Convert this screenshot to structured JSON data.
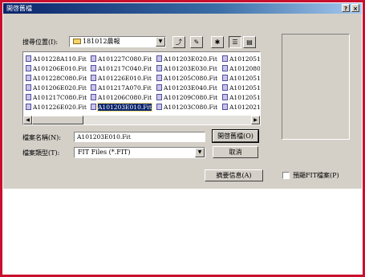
{
  "window": {
    "title": "開啓舊檔"
  },
  "titlebar_buttons": {
    "help": "?",
    "close": "×"
  },
  "look_in": {
    "label": "搜尋位置(I):",
    "value": "181012晨報",
    "tools": [
      "folder-up-icon",
      "refresh-icon",
      "new-folder-icon",
      "list-view-icon",
      "details-view-icon"
    ]
  },
  "files": {
    "columns": [
      [
        "A101228A110.Fit",
        "A101206E010.Fit",
        "A101228C080.Fit",
        "A101206E020.Fit",
        "A101217C080.Fit",
        "A101226E020.Fit"
      ],
      [
        "A101227C080.Fit",
        "A101217C040.Fit",
        "A101226E010.Fit",
        "A101217A070.Fit",
        "A101206C080.Fit",
        "A101203E010.Fit"
      ],
      [
        "A101203E020.Fit",
        "A101203E030.Fit",
        "A101205C080.Fit",
        "A101203E040.Fit",
        "A101209C080.Fit",
        "A101203C080.Fit"
      ],
      [
        "A1012051",
        "A1012080",
        "A1012051",
        "A1012051",
        "A1012051",
        "A1012021"
      ]
    ],
    "selected": "A101203E010.Fit"
  },
  "filename": {
    "label": "檔案名稱(N):",
    "value": "A101203E010.Fit"
  },
  "filetype": {
    "label": "檔案類型(T):",
    "value": "FIT Files (*.FIT)"
  },
  "buttons": {
    "open": "開啓舊檔(O)",
    "cancel": "取消",
    "summary": "摘要信息(A)"
  },
  "preview_checkbox": {
    "label": "預顯FIT檔案(P)",
    "checked": false
  },
  "colors": {
    "accent_border": "#c8102e",
    "titlebar": "#0a246a",
    "face": "#d4d0c8"
  }
}
